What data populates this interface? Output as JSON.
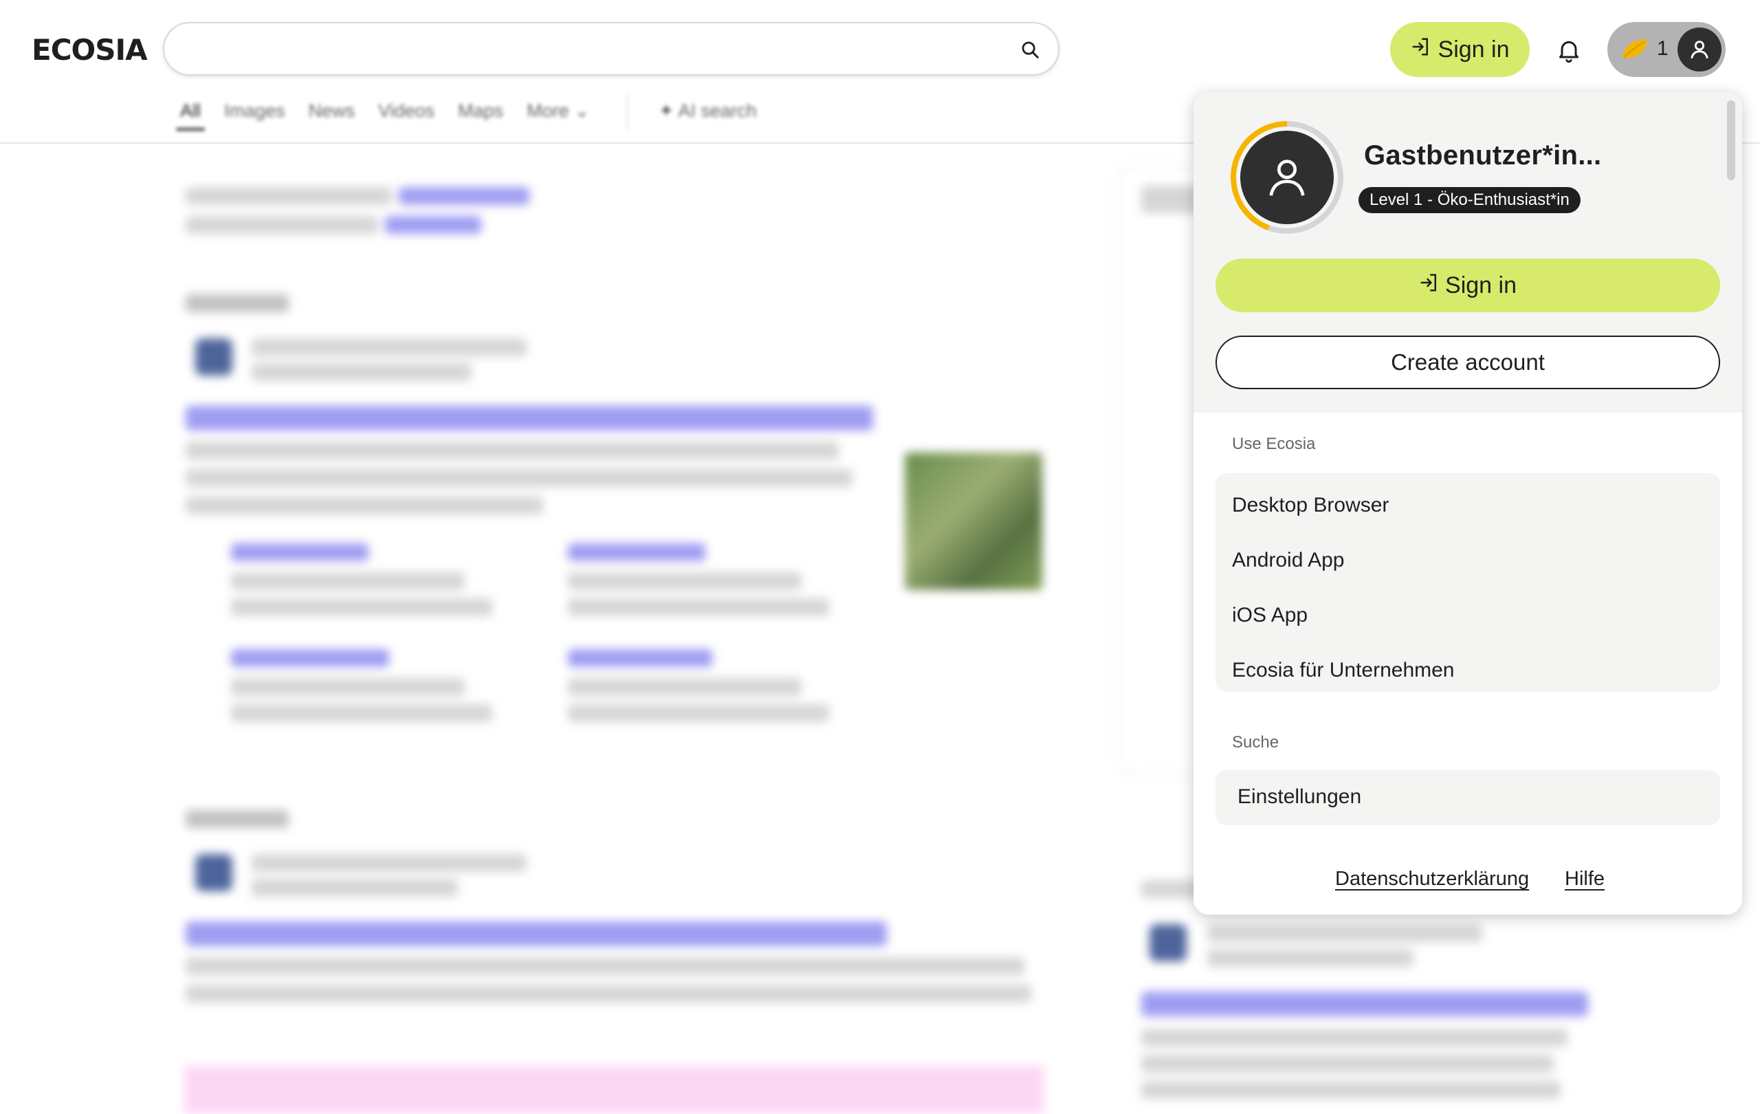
{
  "header": {
    "logo": "ECOSIA",
    "search": {
      "value": "",
      "placeholder": ""
    },
    "tabs": [
      {
        "label": "All",
        "active": true
      },
      {
        "label": "Images"
      },
      {
        "label": "News"
      },
      {
        "label": "Videos"
      },
      {
        "label": "Maps"
      },
      {
        "label": "More"
      }
    ],
    "ai_search": "AI search",
    "sign_in": "Sign in",
    "tree_count": "1",
    "icons": [
      "search-icon",
      "bell-icon",
      "leaf-icon",
      "user-icon",
      "chevron-down-icon",
      "sparkle-icon",
      "sign-in-icon"
    ]
  },
  "account_menu": {
    "username": "Gastbenutzer*in...",
    "level": "Level 1 - Öko-Enthusiast*in",
    "sign_in": "Sign in",
    "create_account": "Create account",
    "use_ecosia": {
      "label": "Use Ecosia",
      "items": [
        "Desktop Browser",
        "Android App",
        "iOS App",
        "Ecosia für Unternehmen"
      ]
    },
    "suche": {
      "label": "Suche",
      "items": [
        "Einstellungen"
      ]
    },
    "footer": {
      "privacy": "Datenschutzerklärung",
      "help": "Hilfe"
    }
  },
  "colors": {
    "accent_green": "#d7ea6b",
    "dark": "#1f1f1f",
    "level_ring": "#f5b400",
    "panel_bg": "#f4f4f2"
  }
}
